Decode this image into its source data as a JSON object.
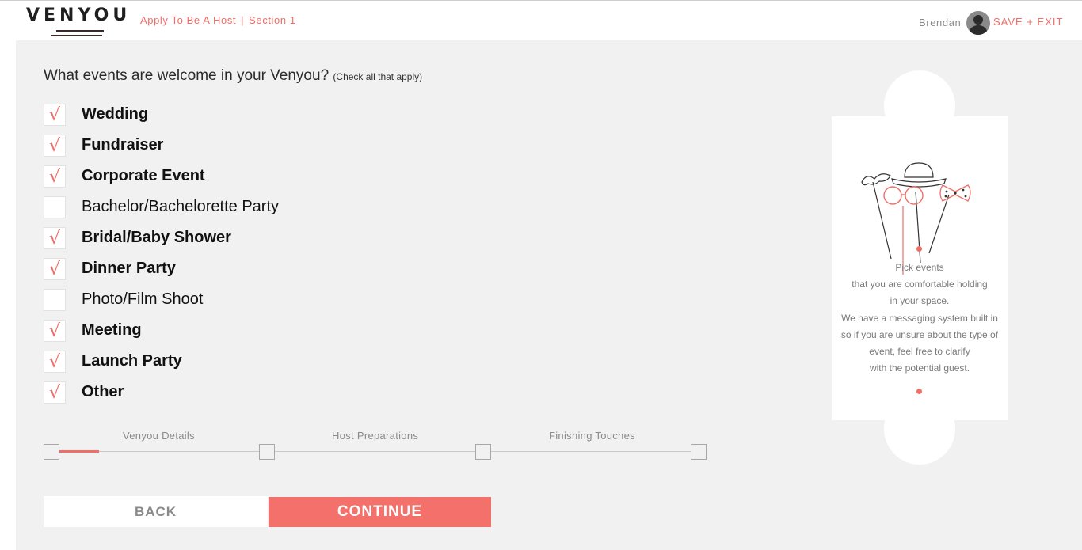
{
  "header": {
    "logo_text": "VENYOU",
    "breadcrumb_title": "Apply To Be A Host",
    "breadcrumb_separator": "|",
    "breadcrumb_section": "Section 1",
    "user_name": "Brendan",
    "save_exit_label": "SAVE + EXIT"
  },
  "colors": {
    "accent": "#f06e68",
    "background": "#f1f1f1"
  },
  "form": {
    "question": "What events are welcome in your Venyou?",
    "question_hint": "(Check all that apply)",
    "options": [
      {
        "label": "Wedding",
        "checked": true
      },
      {
        "label": "Fundraiser",
        "checked": true
      },
      {
        "label": "Corporate Event",
        "checked": true
      },
      {
        "label": "Bachelor/Bachelorette Party",
        "checked": false
      },
      {
        "label": "Bridal/Baby Shower",
        "checked": true
      },
      {
        "label": "Dinner Party",
        "checked": true
      },
      {
        "label": "Photo/Film Shoot",
        "checked": false
      },
      {
        "label": "Meeting",
        "checked": true
      },
      {
        "label": "Launch Party",
        "checked": true
      },
      {
        "label": "Other",
        "checked": true
      }
    ],
    "check_glyph": "√"
  },
  "progress": {
    "steps": [
      "Venyou Details",
      "Host Preparations",
      "Finishing Touches"
    ]
  },
  "buttons": {
    "back": "BACK",
    "continue": "CONTINUE"
  },
  "tip_card": {
    "art_icon": "photo-booth-props-icon",
    "lines": [
      "Pick events",
      "that you are comfortable holding",
      "in your space.",
      "We have a messaging system built in",
      "so if you are unsure about the type of",
      "event, feel free to clarify",
      "with the potential guest."
    ]
  }
}
